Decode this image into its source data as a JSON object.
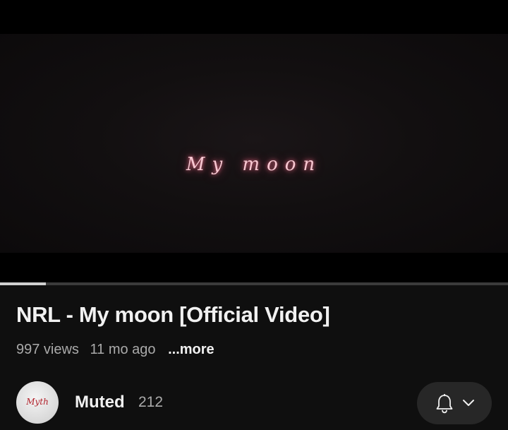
{
  "player": {
    "overlay_title": "My moon",
    "progress_fraction": 0.09
  },
  "video": {
    "title": "NRL - My moon [Official Video]",
    "views": "997 views",
    "age": "11 mo ago",
    "more_label": "...more"
  },
  "channel": {
    "name": "Muted",
    "subscribers": "212",
    "avatar_text": "Myth"
  },
  "icons": {
    "subscribe": "bell-icon",
    "subscribe_menu": "chevron-down-icon"
  },
  "colors": {
    "background": "#0f0f0f",
    "title_glow": "#ff6f93",
    "button_bg": "#272727"
  }
}
